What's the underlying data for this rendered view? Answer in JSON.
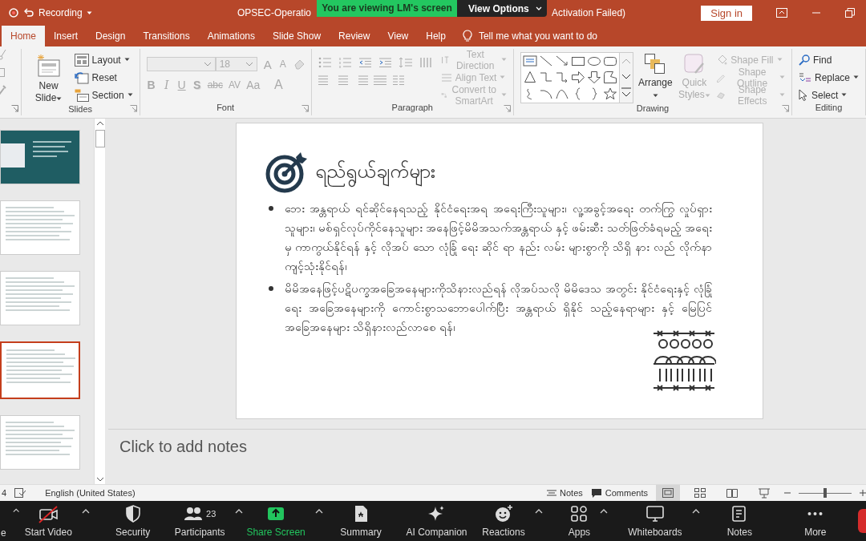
{
  "title_bar": {
    "quick_access_label": "Recording",
    "title_start": "OPSEC-Operatio",
    "title_end": "Activation Failed)",
    "sign_in": "Sign in"
  },
  "share_banner": {
    "message": "You are viewing LM's screen",
    "options": "View Options"
  },
  "ribbon_tabs": [
    {
      "label": "Home",
      "selected": true
    },
    {
      "label": "Insert",
      "selected": false
    },
    {
      "label": "Design",
      "selected": false
    },
    {
      "label": "Transitions",
      "selected": false
    },
    {
      "label": "Animations",
      "selected": false
    },
    {
      "label": "Slide Show",
      "selected": false
    },
    {
      "label": "Review",
      "selected": false
    },
    {
      "label": "View",
      "selected": false
    },
    {
      "label": "Help",
      "selected": false
    }
  ],
  "tell_me": "Tell me what you want to do",
  "ribbon_groups": [
    {
      "label": "Slides",
      "items": [
        {
          "kind": "large",
          "label": "New Slide",
          "caret": true,
          "disabled": false
        },
        {
          "kind": "column",
          "entries": [
            {
              "label": "Layout",
              "caret": true,
              "disabled": false
            },
            {
              "label": "Reset",
              "caret": false,
              "disabled": false
            },
            {
              "label": "Section",
              "caret": true,
              "disabled": false
            }
          ]
        }
      ]
    },
    {
      "label": "Font",
      "items": [
        {
          "kind": "font",
          "size": "18",
          "size_buttons": [
            "A",
            "A"
          ],
          "style_buttons": [
            "B",
            "I",
            "U",
            "S",
            "abc",
            "AV",
            "Aa",
            "A"
          ]
        }
      ]
    },
    {
      "label": "Paragraph",
      "items": [
        {
          "kind": "paragraph"
        },
        {
          "kind": "column",
          "entries": [
            {
              "label": "Text Direction",
              "caret": true,
              "disabled": true
            },
            {
              "label": "Align Text",
              "caret": true,
              "disabled": true
            },
            {
              "label": "Convert to SmartArt",
              "caret": true,
              "disabled": true
            }
          ]
        }
      ]
    },
    {
      "label": "Drawing",
      "items": [
        {
          "kind": "gallery"
        },
        {
          "kind": "large",
          "label": "Arrange",
          "caret": true,
          "disabled": false
        },
        {
          "kind": "large",
          "label": "Quick Styles",
          "caret": true,
          "disabled": true
        },
        {
          "kind": "column",
          "entries": [
            {
              "label": "Shape Fill",
              "caret": true,
              "disabled": true
            },
            {
              "label": "Shape Outline",
              "caret": true,
              "disabled": true
            },
            {
              "label": "Shape Effects",
              "caret": true,
              "disabled": true
            }
          ]
        }
      ]
    },
    {
      "label": "Editing",
      "items": [
        {
          "kind": "column",
          "entries": [
            {
              "label": "Find",
              "caret": false,
              "disabled": false
            },
            {
              "label": "Replace",
              "caret": true,
              "disabled": false
            },
            {
              "label": "Select",
              "caret": true,
              "disabled": false
            }
          ]
        }
      ]
    }
  ],
  "thumbnails": [
    {
      "kind": "image",
      "selected": false
    },
    {
      "kind": "text",
      "selected": false
    },
    {
      "kind": "text",
      "selected": false
    },
    {
      "kind": "text",
      "selected": true
    },
    {
      "kind": "text",
      "selected": false
    }
  ],
  "slide": {
    "title": "ရည်ရွယ်ချက်များ",
    "bullets": [
      "ဘေး အန္တရာယ် ရင်ဆိုင်နေရသည့် နိုင်ငံရေးအရ အရေးကြီးသူများ၊ လူ့အခွင့်အရေး တက်ကြွ လှုပ်ရှားသူများ၊ မစ်ရှင်လုပ်ကိုင်နေသူများ အနေဖြင့်မိမိအသက်အန္တရာယ် နှင့် ဖမ်းဆီး သတ်ဖြတ်ခံရမည့် အရေးမှ ကာကွယ်နိုင်ရန် နှင့် လိုအပ် သော လုံခြုံ ရေး ဆိုင် ရာ နည်း လမ်း များစွာကို သိရှိ နား လည် လိုက်နာကျင့်သုံးနိုင်ရန်၊",
      "မိမိအနေဖြင့်ပဋိပက္ခအခြေအနေများကိုသိနားလည်ရန် လိုအပ်သလို မိမိဒေသ အတွင်း နိုင်ငံရေးနှင့် လုံခြုံ ရေး အခြေအနေများကို ကောင်းစွာသဘောပေါက်ပြီး အန္တရာယ် ရှိနိုင် သည့်နေရာများ နှင့် မြေပြင် အခြေအနေများ သိရှိနားလည်လာစေ ရန်၊"
    ]
  },
  "notes": {
    "placeholder": "Click to add notes"
  },
  "status_bar": {
    "slide_number": "4",
    "language": "English (United States)",
    "notes": "Notes",
    "comments": "Comments",
    "views": [
      {
        "selected": true
      },
      {
        "selected": false
      },
      {
        "selected": false
      },
      {
        "selected": false
      }
    ],
    "zoom_slider": {
      "level": 0.5
    }
  },
  "meeting_toolbar": {
    "items": [
      {
        "label": "e",
        "caret": true,
        "highlighted": false
      },
      {
        "label": "Start Video",
        "caret": true,
        "highlighted": false
      },
      {
        "label": "Security",
        "caret": false,
        "highlighted": false
      },
      {
        "label": "Participants",
        "count": "23",
        "caret": true,
        "highlighted": false
      },
      {
        "label": "Share Screen",
        "caret": true,
        "highlighted": true
      },
      {
        "label": "Summary",
        "caret": false,
        "highlighted": false
      },
      {
        "label": "AI Companion",
        "caret": false,
        "highlighted": false
      },
      {
        "label": "Reactions",
        "caret": true,
        "highlighted": false
      },
      {
        "label": "Apps",
        "caret": true,
        "highlighted": false
      },
      {
        "label": "Whiteboards",
        "caret": true,
        "highlighted": false
      },
      {
        "label": "Notes",
        "caret": false,
        "highlighted": false
      },
      {
        "label": "More",
        "caret": false,
        "highlighted": false
      }
    ]
  }
}
